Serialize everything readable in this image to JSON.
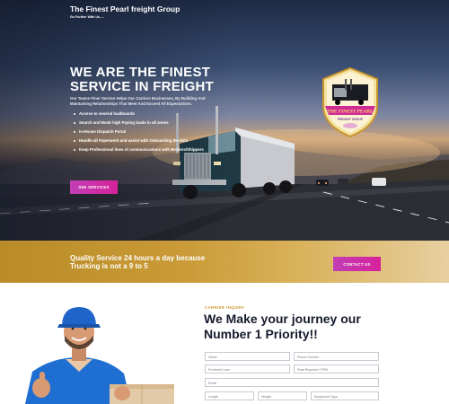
{
  "header": {
    "brand": "The Finest Pearl freight Group",
    "tagline": "Go Further With Us....."
  },
  "hero": {
    "headline": "WE ARE THE FINEST SERVICE IN FREIGHT",
    "intro": "Our Teams Finer Service Helps Our Carriers Businesses, By Building And Maintaining Relationships That Meet And Exceed All Expectations.",
    "bullets": [
      "Access to several loadboards",
      "Search and Book high Paying loads in all zones",
      "In-House Dispatch Portal",
      "Handle all Paperwork and assist with Onboarding the lists",
      "Keep Professional lines of communications with Brokers/Shippers"
    ],
    "cta_label": "SEE SERVICES",
    "logo_text": "THE FINEST PEARL",
    "logo_subtext": "FREIGHT GROUP"
  },
  "band": {
    "text": "Quality Service 24 hours a day because Trucking is not a 9 to 5",
    "cta_label": "CONTACT US"
  },
  "inquiry": {
    "kicker": "CARRIER INQUIRY",
    "title": "We Make your journey our Number 1 Priority!!",
    "fields": {
      "name": "Name",
      "phone": "Phone Number",
      "preferred_lane": "Preferred Lane",
      "rate": "Rate Required / RPM",
      "email": "Email",
      "length": "Length",
      "weight": "Weight",
      "equipment": "Equipment Type"
    }
  },
  "colors": {
    "accent_magenta": "#d6229b",
    "gold": "#c99a36",
    "navy_text": "#151a2e"
  }
}
